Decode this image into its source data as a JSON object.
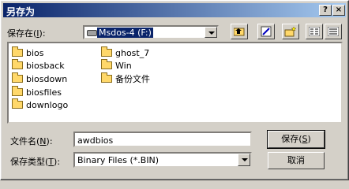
{
  "window": {
    "title": "另存为",
    "help_label": "?",
    "close_label": "×"
  },
  "location": {
    "label_text": "保存在",
    "label_key": "I",
    "drive": "Msdos-4 (F:)"
  },
  "folders": [
    "bios",
    "biosback",
    "biosdown",
    "biosfiles",
    "downlogo",
    "ghost_7",
    "Win",
    "备份文件"
  ],
  "filename": {
    "label_text": "文件名",
    "label_key": "N",
    "value": "awdbios"
  },
  "filetype": {
    "label_text": "保存类型",
    "label_key": "T",
    "value": "Binary Files (*.BIN)"
  },
  "buttons": {
    "save_text": "保存",
    "save_key": "S",
    "cancel": "取消"
  }
}
